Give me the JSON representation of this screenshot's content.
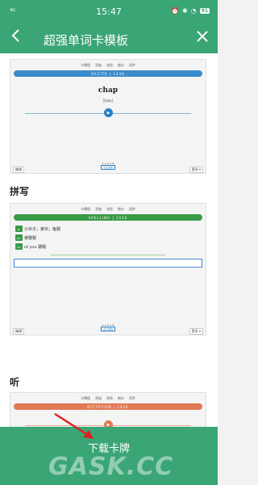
{
  "status_bar": {
    "signal": "4G",
    "time": "15:47",
    "battery": "91"
  },
  "app_bar": {
    "back_icon": "←",
    "title": "超强单词卡模板",
    "close_icon": "✕"
  },
  "card_nav": [
    "卡牌组",
    "添加",
    "浏览",
    "统计",
    "同步"
  ],
  "recite_card": {
    "banner": "RECITE | 1430",
    "banner_color": "#3a8ccc",
    "word": "chap",
    "phonetic": "[tʃæp]",
    "progress": "1 + 2 + 0",
    "mid_button": "显示答案",
    "left_button": "编辑",
    "right_button": "更多 ▾"
  },
  "spelling_section": {
    "title": "拼写"
  },
  "spelling_card": {
    "banner": "SPELLING | 1430",
    "banner_color": "#3a9a48",
    "lines": [
      {
        "tag": "n.",
        "text": "小伙子；家伙；龟裂"
      },
      {
        "tag": "vt.",
        "text": "使皲裂"
      },
      {
        "tag": "vi.",
        "text": "of you 皲裂"
      }
    ],
    "progress": "1 + 2 + 0",
    "mid_button": "显示答案",
    "left_button": "编辑",
    "right_button": "更多 ▾"
  },
  "dictation_section": {
    "title": "听"
  },
  "dictation_card": {
    "banner": "DICTATION | 1430",
    "banner_color": "#e07a55"
  },
  "download": {
    "label": "下载卡牌"
  },
  "watermark": "GASK.CC",
  "colors": {
    "primary": "#3aa575",
    "arrow": "#e02020"
  }
}
